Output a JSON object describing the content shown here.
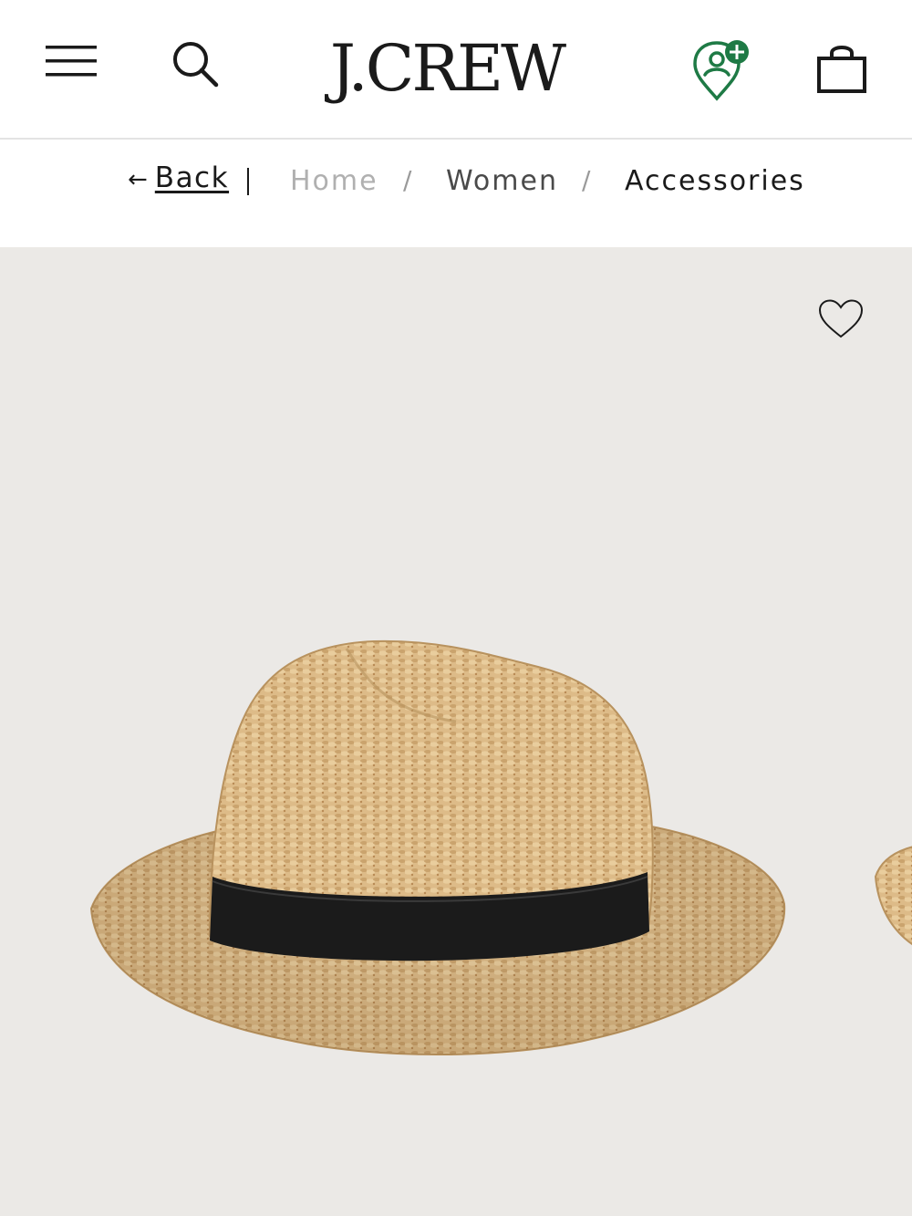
{
  "header": {
    "menu_icon": "hamburger-menu-icon",
    "search_icon": "search-icon",
    "logo": "J.CREW",
    "store_icon": "store-locator-pin-icon",
    "bag_icon": "shopping-bag-icon",
    "accent_green": "#1e7a45"
  },
  "breadcrumb": {
    "back_arrow": "←",
    "back_label": "Back",
    "divider": "|",
    "items": [
      "Home",
      "Women",
      "Accessories"
    ],
    "separator": "/"
  },
  "product": {
    "wishlist_icon": "heart-outline-icon",
    "image": "straw-fedora-hat-with-black-band",
    "background": "#ebe9e6"
  }
}
